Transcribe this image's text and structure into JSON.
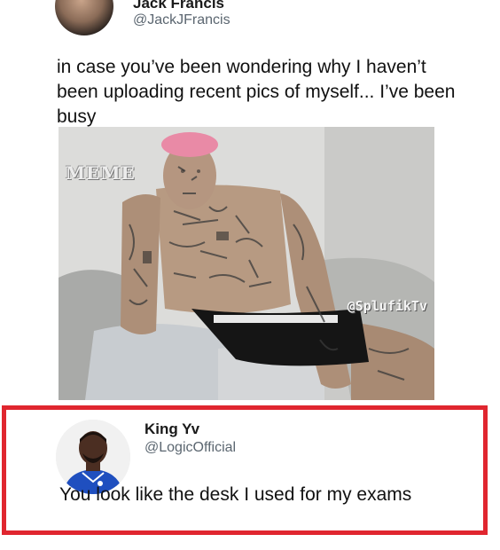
{
  "tweet": {
    "author_name": "Jack Francis",
    "author_handle": "@JackJFrancis",
    "text": "in case you’ve been wondering why I haven’t been uploading recent pics of myself... I’ve been busy",
    "photo": {
      "watermark_left": "MEME",
      "watermark_right": "@SplufikTv"
    }
  },
  "reply": {
    "author_name": "King Yv",
    "author_handle": "@LogicOfficial",
    "text": "You look like the desk I used for my exams",
    "highlight_color": "#e0262f"
  }
}
